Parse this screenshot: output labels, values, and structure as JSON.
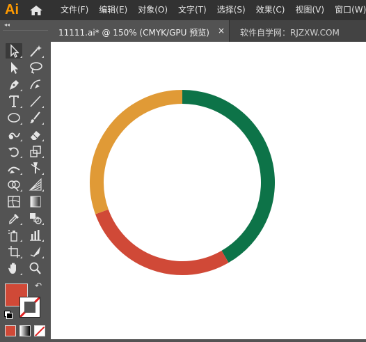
{
  "app": {
    "logo_text": "Ai",
    "logo_color": "#ff9a00"
  },
  "menu": [
    "文件(F)",
    "编辑(E)",
    "对象(O)",
    "文字(T)",
    "选择(S)",
    "效果(C)",
    "视图(V)",
    "窗口(W)"
  ],
  "panel": {
    "collapse_glyph": "◂◂"
  },
  "tabs": {
    "active": {
      "label": "11111.ai* @ 150% (CMYK/GPU 预览)",
      "close_glyph": "×"
    },
    "inactive": {
      "label": "软件自学网：RJZXW.COM"
    }
  },
  "tools": [
    "selection-tool-icon",
    "magic-wand-icon",
    "direct-selection-icon",
    "lasso-icon",
    "pen-tool-icon",
    "curvature-icon",
    "type-tool-icon",
    "line-segment-icon",
    "ellipse-tool-icon",
    "paintbrush-icon",
    "shaper-tool-icon",
    "eraser-icon",
    "rotate-tool-icon",
    "scale-tool-icon",
    "width-tool-icon",
    "puppet-warp-icon",
    "shape-builder-icon",
    "perspective-grid-icon",
    "mesh-tool-icon",
    "gradient-tool-icon",
    "eyedropper-icon",
    "blend-tool-icon",
    "symbol-sprayer-icon",
    "column-graph-icon",
    "artboard-tool-icon",
    "slice-tool-icon",
    "hand-tool-icon",
    "zoom-tool-icon"
  ],
  "colors": {
    "fill": "#d04937",
    "stroke": "none",
    "swap_glyph": "↶",
    "modes": [
      "color-mode-icon",
      "gradient-mode-icon",
      "none-mode-icon"
    ]
  },
  "artwork": {
    "ring": [
      {
        "name": "green",
        "color": "#0d7348",
        "start_deg": 0,
        "end_deg": 150
      },
      {
        "name": "red",
        "color": "#d04937",
        "start_deg": 150,
        "end_deg": 250
      },
      {
        "name": "orange",
        "color": "#e09a36",
        "start_deg": 250,
        "end_deg": 360
      }
    ]
  }
}
